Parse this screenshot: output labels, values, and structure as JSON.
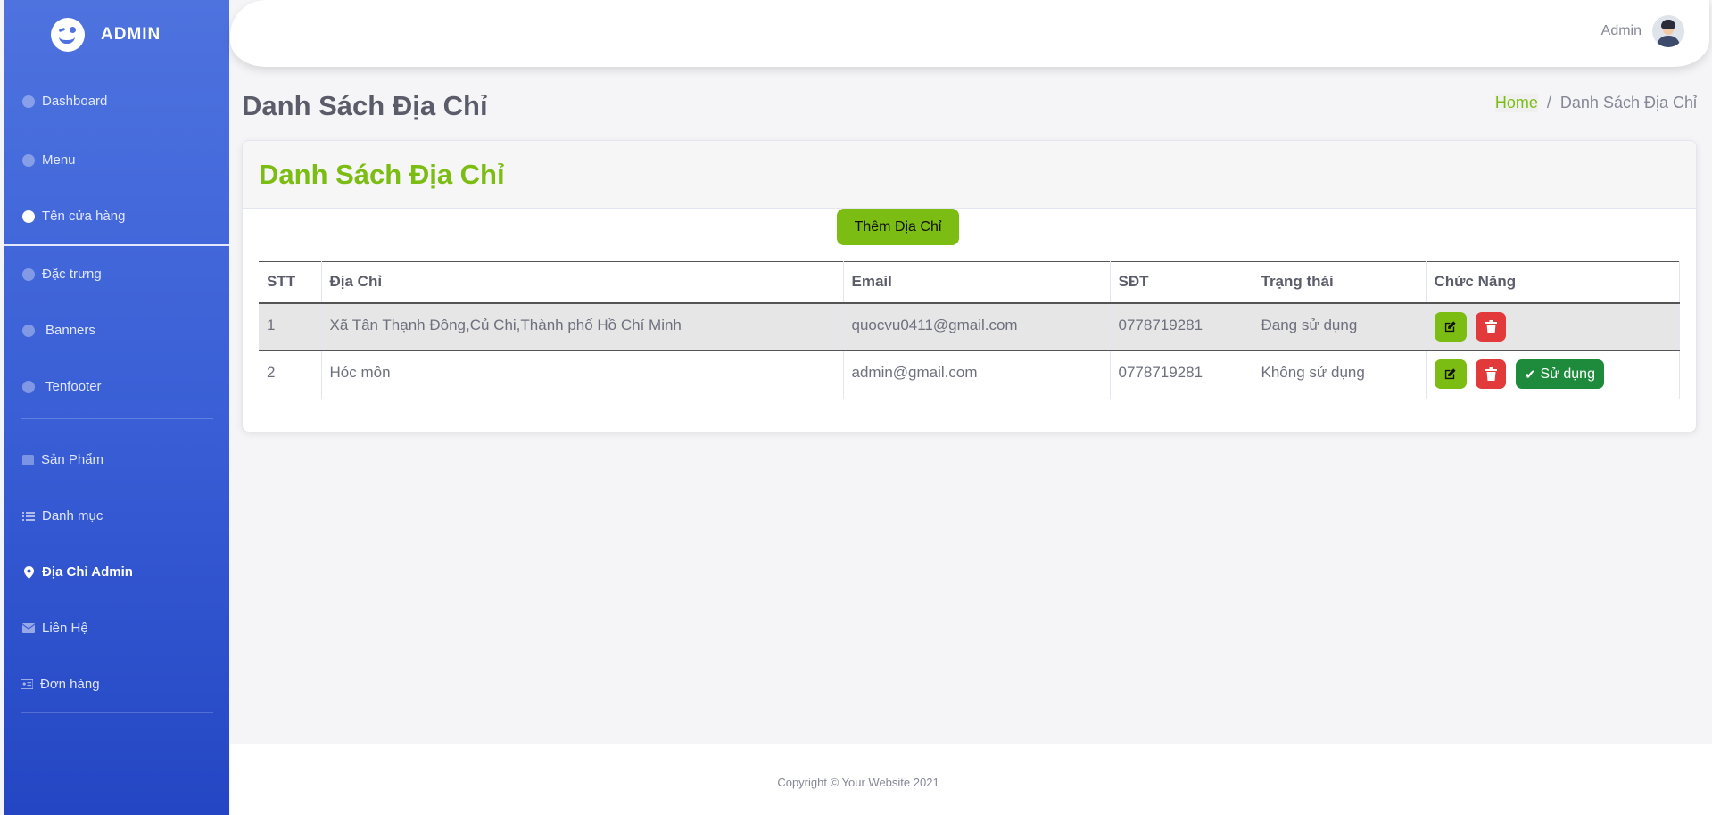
{
  "brand": {
    "text": "ADMIN",
    "icon": "wink-smiley-logo"
  },
  "sidebar": {
    "items": [
      {
        "label": "Dashboard",
        "icon": "gauge-icon"
      },
      {
        "label": "Menu",
        "icon": "gauge-icon"
      },
      {
        "label": "Tên cửa hàng",
        "icon": "palette-icon"
      },
      {
        "label": "Đặc trưng",
        "icon": "gauge-icon"
      },
      {
        "label": "Banners",
        "icon": "gauge-icon"
      },
      {
        "label": "Tenfooter",
        "icon": "gauge-icon"
      },
      {
        "label": "Sản Phẩm",
        "icon": "calendar-icon"
      },
      {
        "label": "Danh mục",
        "icon": "list-icon"
      },
      {
        "label": "Địa Chỉ Admin",
        "icon": "map-pin-icon",
        "active": true
      },
      {
        "label": "Liên Hệ",
        "icon": "envelope-icon"
      },
      {
        "label": "Đơn hàng",
        "icon": "id-card-icon"
      }
    ]
  },
  "topbar": {
    "user_name": "Admin"
  },
  "page": {
    "title": "Danh Sách Địa Chỉ",
    "breadcrumb": {
      "home": "Home",
      "separator": "/",
      "current": "Danh Sách Địa Chỉ"
    }
  },
  "card": {
    "title": "Danh Sách Địa Chỉ",
    "add_button": "Thêm Địa Chỉ"
  },
  "table": {
    "headers": [
      "STT",
      "Địa Chỉ",
      "Email",
      "SĐT",
      "Trạng thái",
      "Chức Năng"
    ],
    "rows": [
      {
        "stt": "1",
        "address": "Xã Tân Thạnh Đông,Củ Chi,Thành phố Hồ Chí Minh",
        "email": "quocvu0411@gmail.com",
        "phone": "0778719281",
        "status": "Đang sử dụng"
      },
      {
        "stt": "2",
        "address": "Hóc môn",
        "email": "admin@gmail.com",
        "phone": "0778719281",
        "status": "Không sử dụng",
        "use_button": "Sử dụng"
      }
    ]
  },
  "footer": {
    "copyright": "Copyright © Your Website 2021"
  },
  "colors": {
    "sidebar": "#4e73df",
    "accent_green": "#7cbd14",
    "danger": "#e23a3a",
    "success": "#1e8a3c"
  }
}
